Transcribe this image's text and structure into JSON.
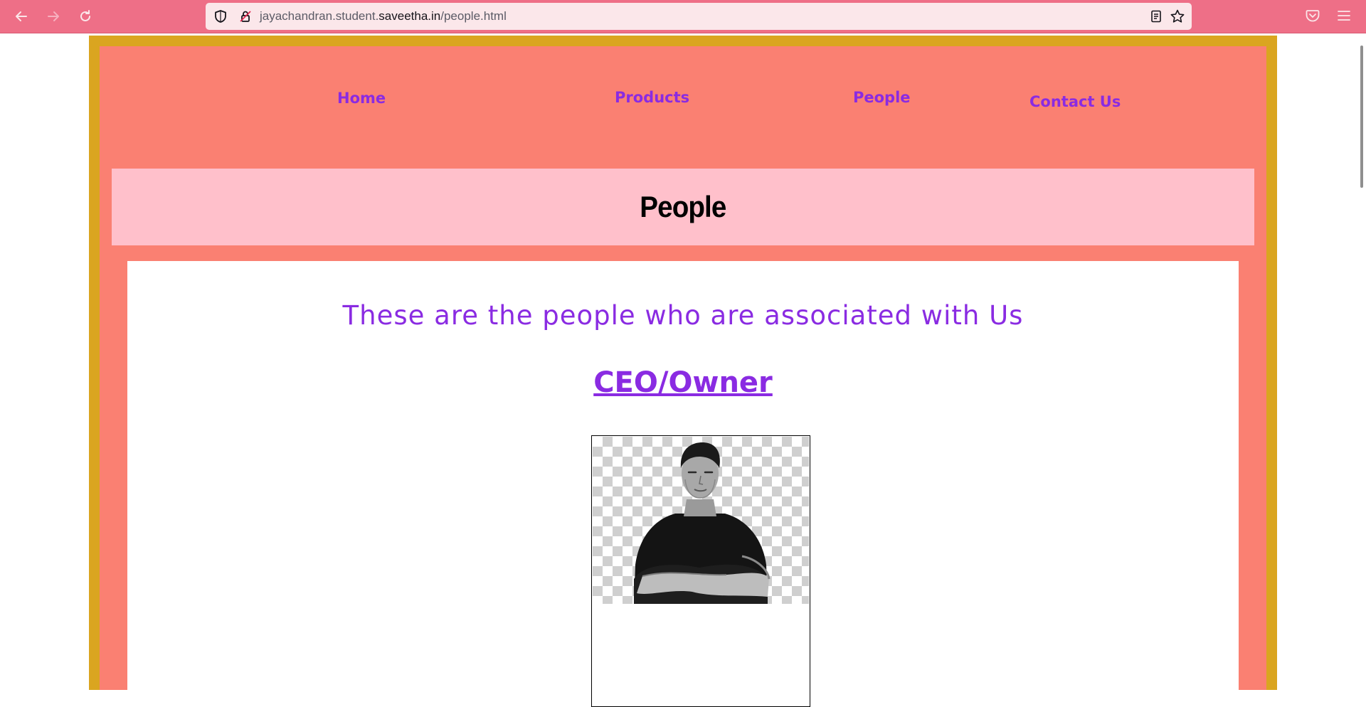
{
  "browser": {
    "url_prefix": "jayachandran.student.",
    "url_host": "saveetha.in",
    "url_path": "/people.html"
  },
  "nav": {
    "items": [
      {
        "label": "Home"
      },
      {
        "label": "Products"
      },
      {
        "label": "People"
      },
      {
        "label": "Contact Us"
      }
    ]
  },
  "header": {
    "title": "People"
  },
  "main": {
    "intro": "These are the people who are associated with Us",
    "role_heading": "CEO/Owner"
  },
  "colors": {
    "toolbar": "#ee6f87",
    "frame": "#daa520",
    "page_bg": "#fa8072",
    "header_bg": "#ffc0cb",
    "link": "#8a2be2"
  }
}
